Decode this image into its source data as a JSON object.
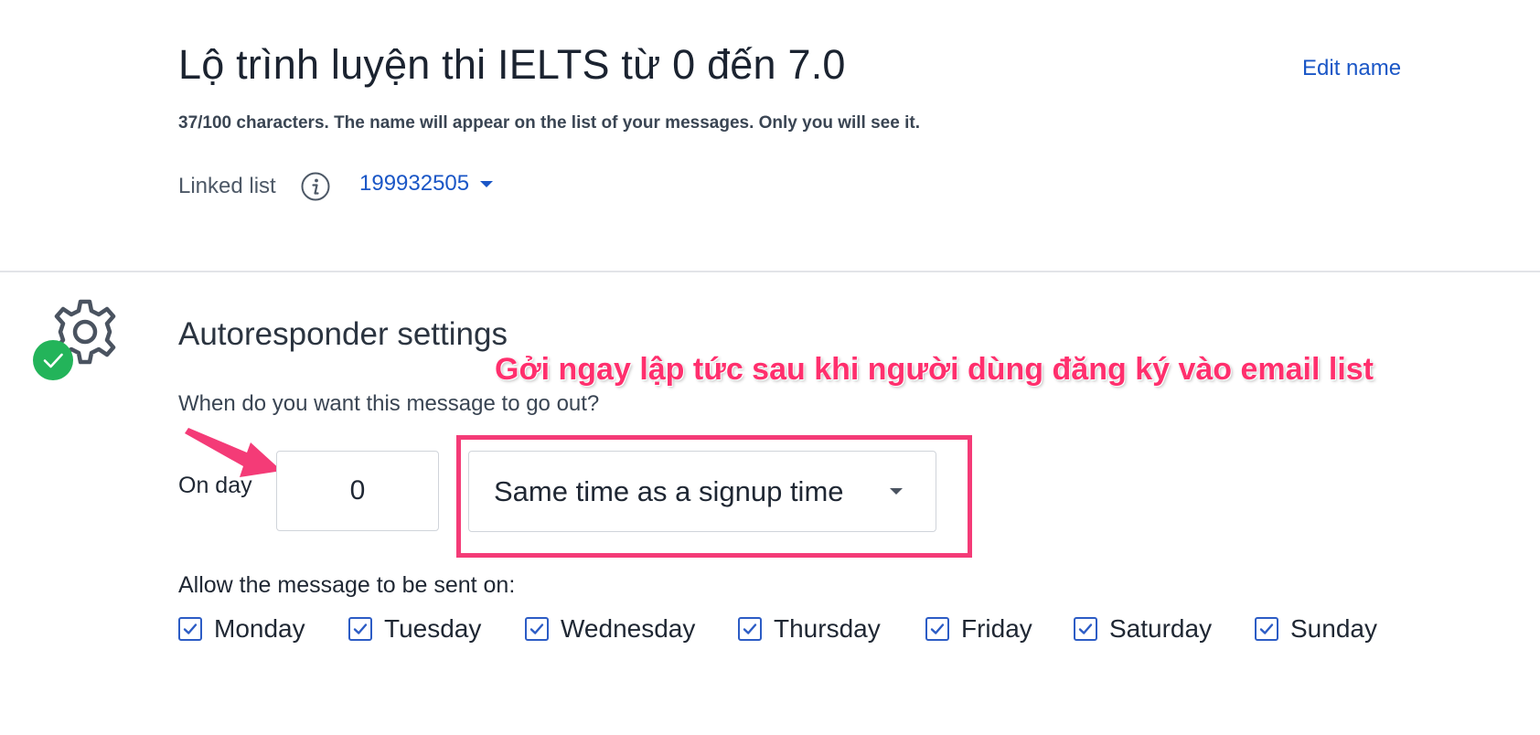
{
  "header": {
    "title": "Lộ trình luyện thi IELTS từ 0 đến 7.0",
    "edit_link": "Edit name",
    "char_hint": "37/100 characters. The name will appear on the list of your messages. Only you will see it."
  },
  "linked_list": {
    "label": "Linked list",
    "value": "199932505"
  },
  "autoresponder": {
    "title": "Autoresponder settings",
    "question": "When do you want this message to go out?",
    "on_day_label": "On day",
    "day_value": "0",
    "time_option": "Same time as a signup time",
    "allow_label": "Allow the message to be sent on:",
    "days": [
      {
        "label": "Monday",
        "checked": true
      },
      {
        "label": "Tuesday",
        "checked": true
      },
      {
        "label": "Wednesday",
        "checked": true
      },
      {
        "label": "Thursday",
        "checked": true
      },
      {
        "label": "Friday",
        "checked": true
      },
      {
        "label": "Saturday",
        "checked": true
      },
      {
        "label": "Sunday",
        "checked": true
      }
    ]
  },
  "annotation": {
    "text": "Gởi ngay lập tức sau khi người dùng đăng ký vào email list"
  },
  "colors": {
    "link": "#1a56c6",
    "annotation": "#ff2f6d",
    "success": "#23b45a",
    "checkbox": "#2c5cc5"
  },
  "icons": {
    "info": "info-icon",
    "gear": "gear-icon",
    "check_badge": "check-badge-icon",
    "annotation_arrow": "arrow-icon",
    "dropdown": "caret-down-icon"
  }
}
